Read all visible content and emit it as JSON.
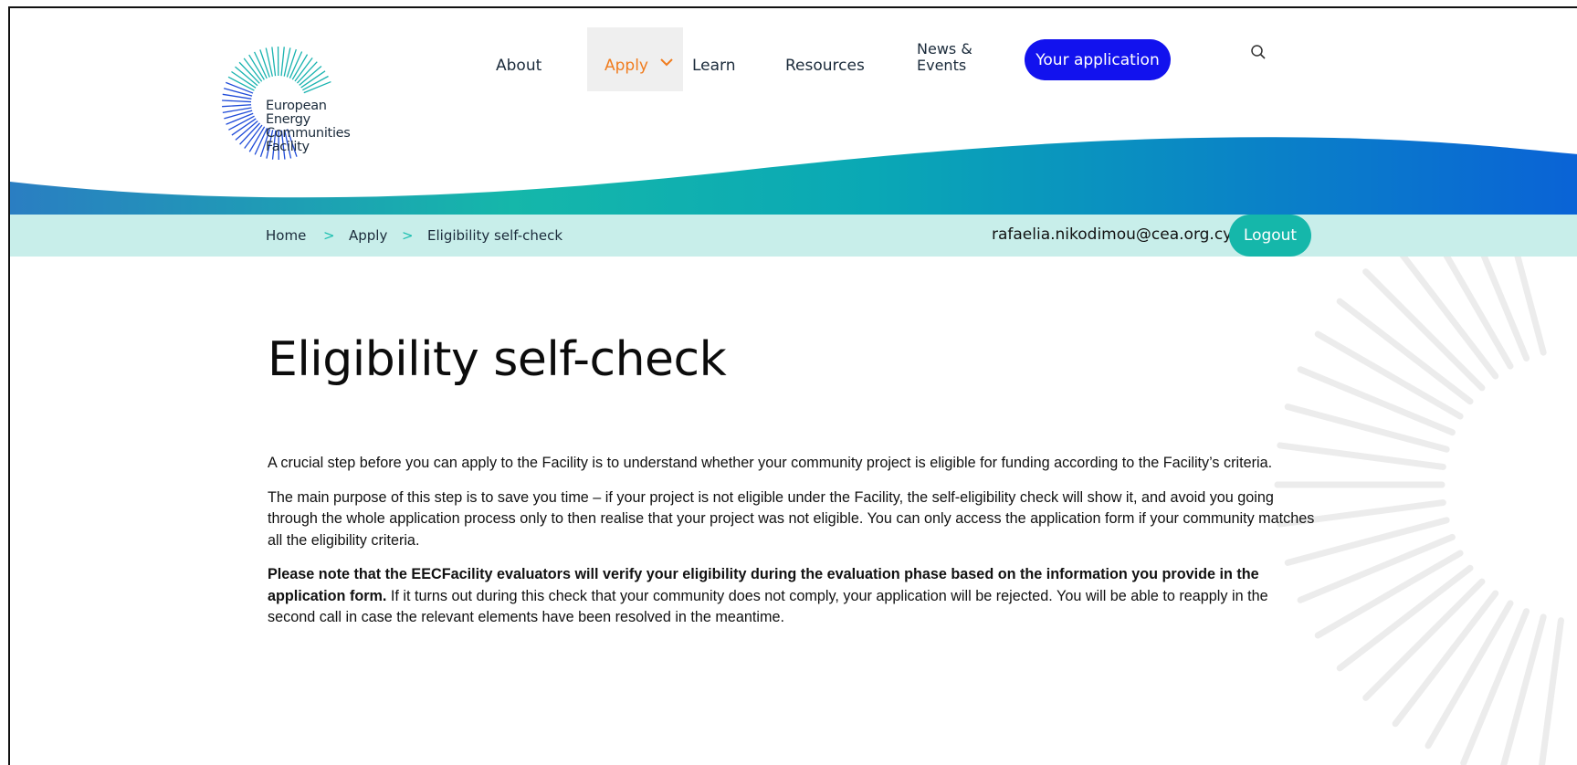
{
  "logo": {
    "lines": [
      "European",
      "Energy",
      "Communities",
      "Facility"
    ]
  },
  "nav": {
    "items": [
      {
        "label": "About"
      },
      {
        "label": "Apply"
      },
      {
        "label": "Learn"
      },
      {
        "label": "Resources"
      },
      {
        "label": "News &"
      },
      {
        "label": "Events"
      }
    ],
    "active": "Apply",
    "application_button": "Your application",
    "search_icon": "search-icon"
  },
  "breadcrumb": {
    "home": "Home",
    "apply": "Apply",
    "current": "Eligibility self-check",
    "separator": ">"
  },
  "user": {
    "email": "rafaelia.nikodimou@cea.org.cy",
    "logout_label": "Logout"
  },
  "page": {
    "title": "Eligibility self-check",
    "paragraph1": "A crucial step before you can apply to the Facility is to understand whether your community project is eligible for funding according to the Facility’s criteria.",
    "paragraph2": "The main purpose of this step is to save you time – if your project is not eligible under the Facility, the self-eligibility check will show it, and avoid you going through the whole application process only to then realise that your project was not eligible. You can only access the application form if your community matches all the eligibility criteria.",
    "paragraph3_bold": "Please note that the EECFacility evaluators will verify your eligibility during the evaluation phase based on the information you provide in the application form.",
    "paragraph3_rest": " If it turns out during this check that your community does not comply, your application will be rejected. You will be able to reapply in the second call in case the relevant elements have been resolved in the meantime."
  },
  "colors": {
    "nav_active": "#f07c1e",
    "primary_button": "#1212ee",
    "teal": "#15b7aa",
    "breadcrumb_bar": "#c8eeea"
  }
}
